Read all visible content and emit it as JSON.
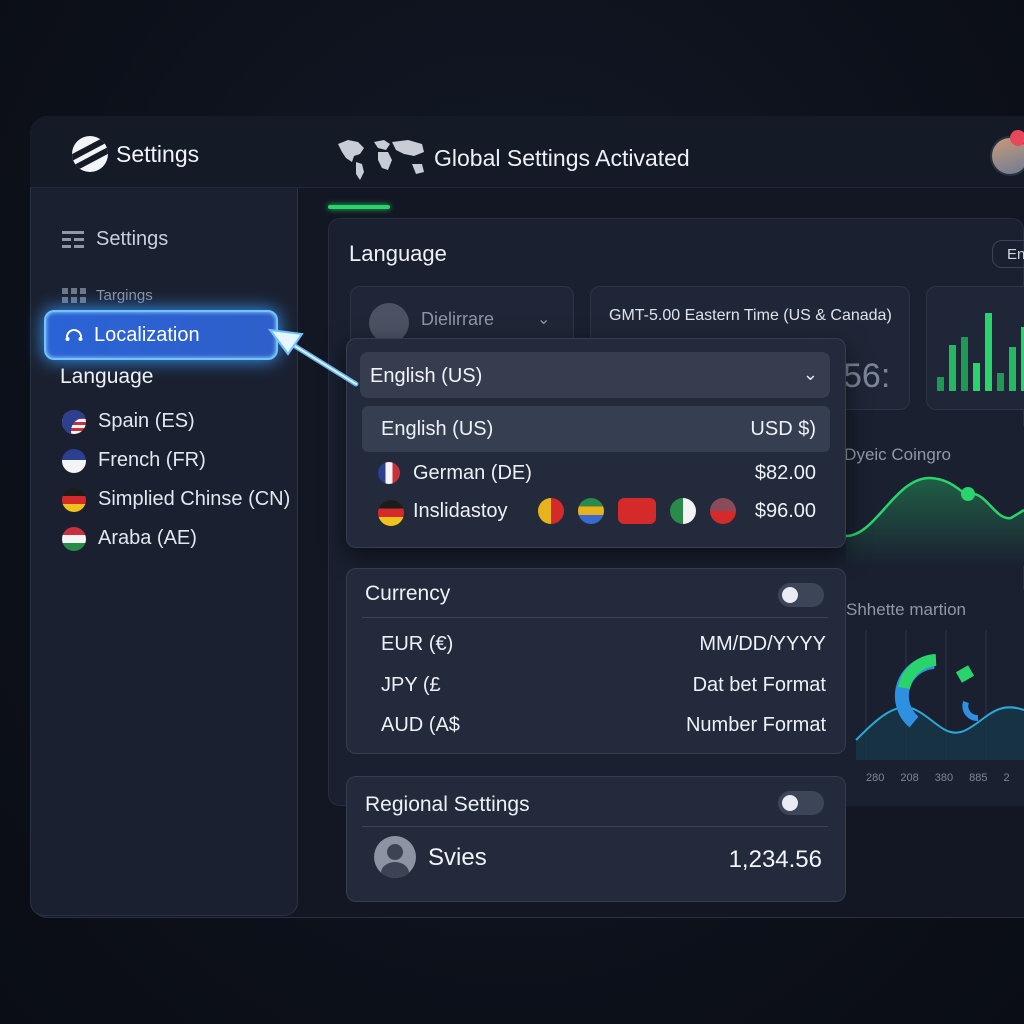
{
  "header": {
    "brand_title": "Settings",
    "banner_title": "Global Settings Activated"
  },
  "sidebar": {
    "heading": "Settings",
    "subheading": "Targings",
    "active_item": "Localization",
    "language_heading": "Language",
    "languages": [
      {
        "label": "Spain (ES)",
        "flag": "us"
      },
      {
        "label": "French (FR)",
        "flag": "fr"
      },
      {
        "label": "Simplied Chinse (CN)",
        "flag": "de"
      },
      {
        "label": "Araba (AE)",
        "flag": "ae"
      }
    ]
  },
  "language_panel": {
    "title": "Language",
    "pill": "En",
    "card_text": "Dielirrare",
    "timezone": "GMT-5.00 Eastern Time (US & Canada)",
    "tz_number": "56:",
    "wave_title": "2 Dyeic Coingro",
    "ring_title": "Shhette martion",
    "ring_ticks": [
      "280",
      "208",
      "380",
      "885",
      "2"
    ]
  },
  "dropdown": {
    "selected": "English (US)",
    "options": [
      {
        "label": "English (US)",
        "value": "USD $)"
      },
      {
        "label": "German (DE)",
        "value": "$82.00"
      },
      {
        "label": "Inslidastoy",
        "value": "$96.00"
      }
    ]
  },
  "currency": {
    "title": "Currency",
    "rows": [
      {
        "left": "EUR (€)",
        "right": "MM/DD/YYYY"
      },
      {
        "left": "JPY (£",
        "right": "Dat bet Format"
      },
      {
        "left": "AUD (A$",
        "right": "Number Format"
      }
    ]
  },
  "regional": {
    "title": "Regional Settings",
    "name": "Svies",
    "number": "1,234.56"
  },
  "colors": {
    "accent_green": "#2ad46c",
    "accent_blue": "#2a63d6",
    "glow": "#6fc3ff"
  }
}
